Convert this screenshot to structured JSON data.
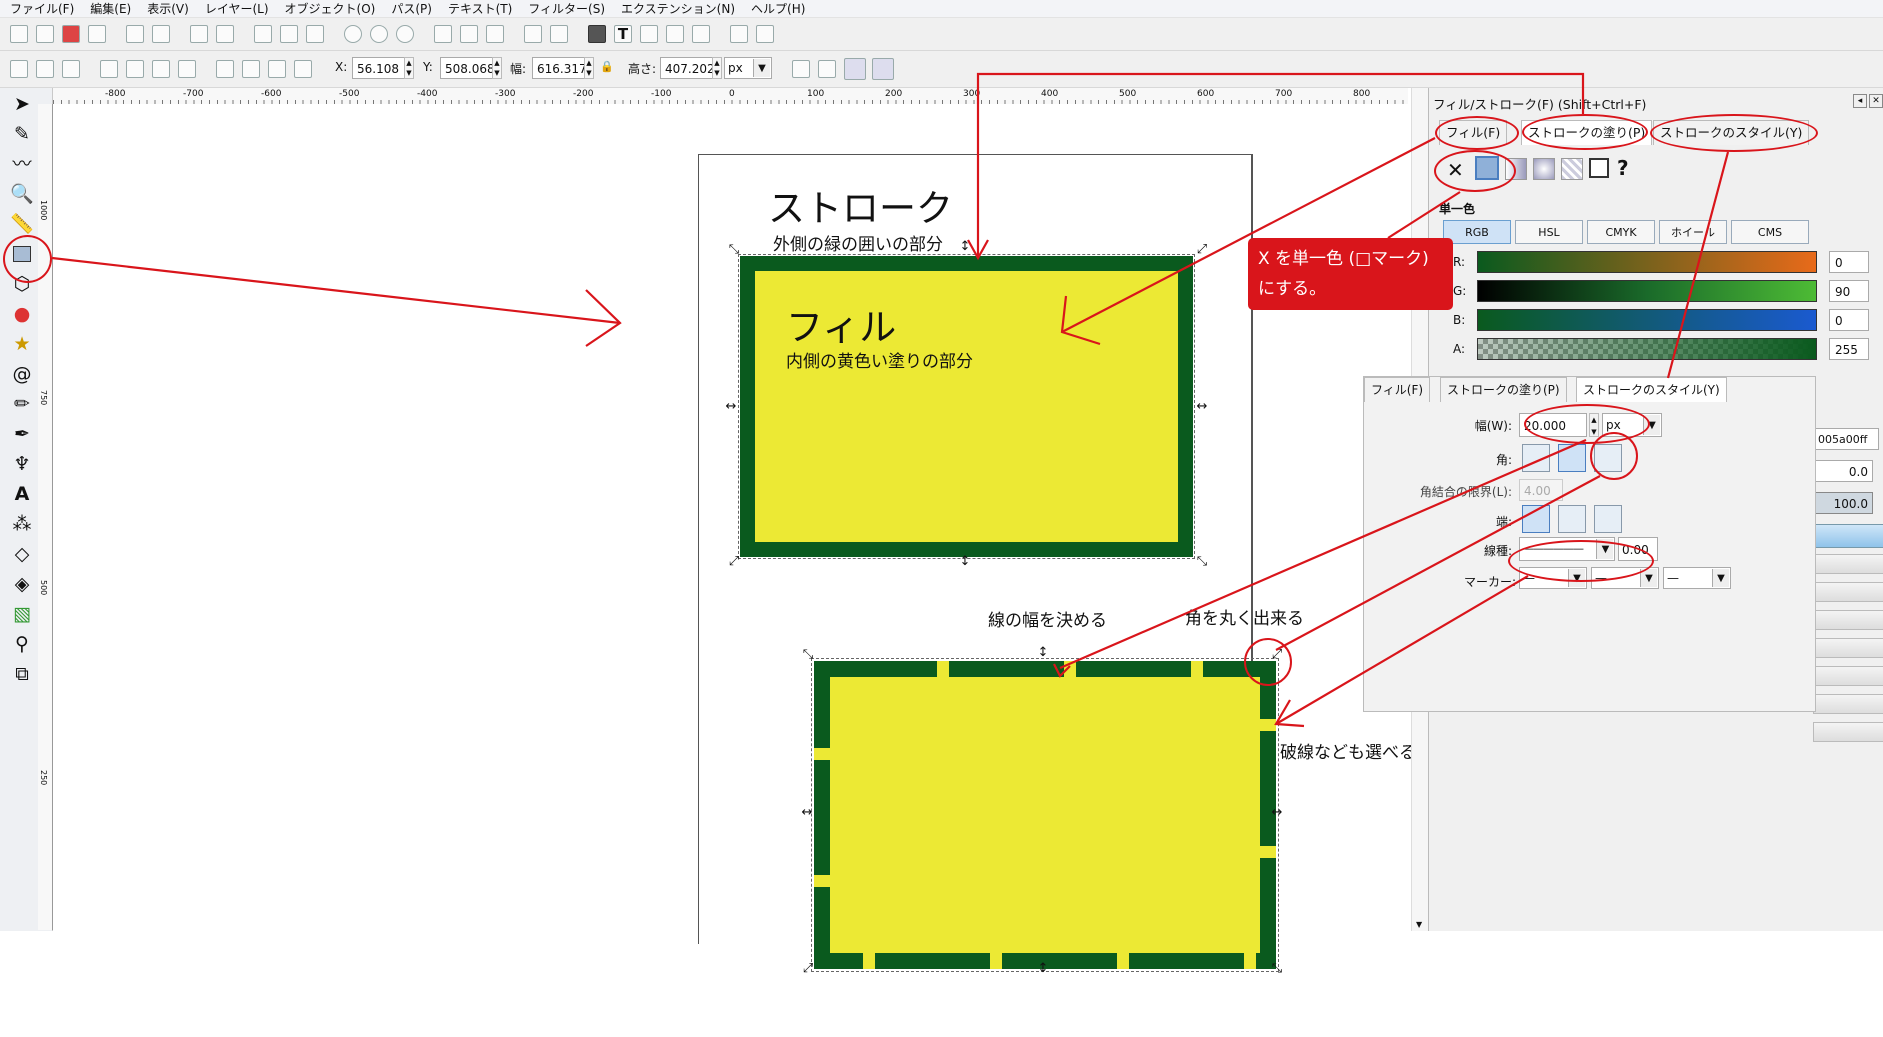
{
  "menu": [
    "ファイル(F)",
    "編集(E)",
    "表示(V)",
    "レイヤー(L)",
    "オブジェクト(O)",
    "パス(P)",
    "テキスト(T)",
    "フィルター(S)",
    "エクステンション(N)",
    "ヘルプ(H)"
  ],
  "coords": {
    "x_label": "X:",
    "x_value": "56.108",
    "y_label": "Y:",
    "y_value": "508.068",
    "w_label": "幅:",
    "w_value": "616.317",
    "h_label": "高さ:",
    "h_value": "407.202",
    "unit": "px"
  },
  "rulers": {
    "h_ticks": [
      "-800",
      "-700",
      "-600",
      "-500",
      "-400",
      "-300",
      "-200",
      "-100",
      "0",
      "100",
      "200",
      "300",
      "400",
      "500",
      "600",
      "700",
      "800"
    ],
    "v_ticks": [
      "1000",
      "750",
      "500",
      "250"
    ]
  },
  "canvas": {
    "fill_color": "#ece934",
    "stroke_color": "#0a5a1e"
  },
  "panel": {
    "title": "フィル/ストローク(F) (Shift+Ctrl+F)",
    "tabs": [
      "フィル(F)",
      "ストロークの塗り(P)",
      "ストロークのスタイル(Y)"
    ],
    "flat_color_label": "単一色",
    "unset_glyph": "✕",
    "unknown_glyph": "?",
    "modes": [
      "RGB",
      "HSL",
      "CMYK",
      "ホイール",
      "CMS"
    ],
    "channels": [
      {
        "label": "R:",
        "value": "0"
      },
      {
        "label": "G:",
        "value": "90"
      },
      {
        "label": "B:",
        "value": "0"
      },
      {
        "label": "A:",
        "value": "255"
      }
    ],
    "rgba_label": "005a00ff",
    "side_value_1": "0.0",
    "side_value_2": "100.0"
  },
  "stroke_style": {
    "tabs": [
      "フィル(F)",
      "ストロークの塗り(P)",
      "ストロークのスタイル(Y)"
    ],
    "width_label": "幅(W):",
    "width_value": "20.000",
    "width_unit": "px",
    "join_label": "角:",
    "miter_label": "角結合の限界(L):",
    "miter_value": "4.00",
    "cap_label": "端:",
    "dash_label": "線種:",
    "dash_pattern": "——————",
    "dash_offset": "0.00",
    "marker_label": "マーカー:",
    "marker_value": "—"
  },
  "annotations": {
    "stroke_title": "ストローク",
    "stroke_desc": "外側の緑の囲いの部分",
    "fill_title": "フィル",
    "fill_desc": "内側の黄色い塗りの部分",
    "callout_line1": "X を単一色 (□マーク)",
    "callout_line2": "にする。",
    "width_note": "線の幅を決める",
    "corner_note": "角を丸く出来る",
    "dash_note": "破線なども選べる"
  }
}
